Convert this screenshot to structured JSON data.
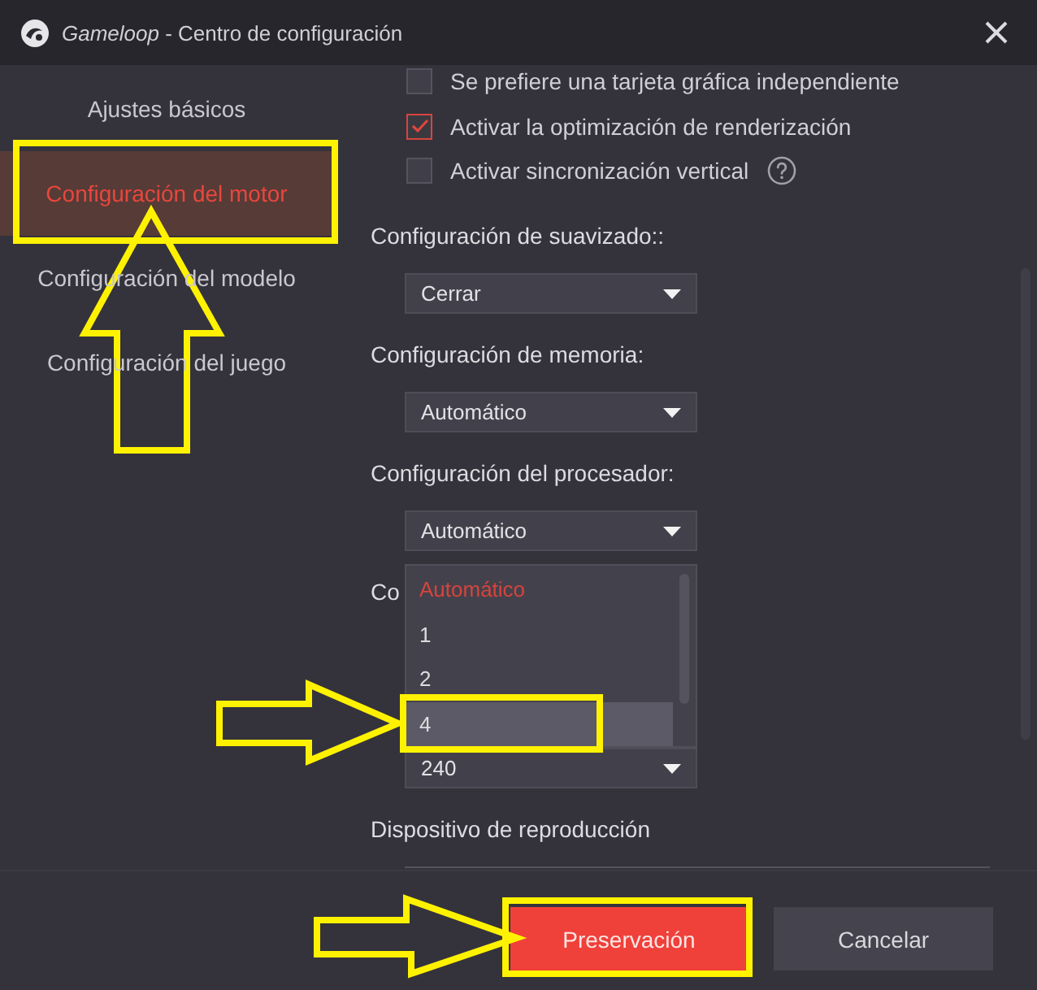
{
  "window": {
    "title": "*Gameloop* - Centro de configuración"
  },
  "sidebar": {
    "items": [
      {
        "label": "Ajustes básicos",
        "selected": false
      },
      {
        "label": "Configuración del motor",
        "selected": true
      },
      {
        "label": "Configuración del modelo",
        "selected": false
      },
      {
        "label": "Configuración del juego",
        "selected": false
      }
    ]
  },
  "options": [
    {
      "label": "Se prefiere una tarjeta gráfica independiente",
      "checked": false
    },
    {
      "label": "Activar la optimización de renderización",
      "checked": true
    },
    {
      "label": "Activar sincronización vertical",
      "checked": false,
      "help": true
    }
  ],
  "settings": [
    {
      "label": "Configuración de suavizado::",
      "value": "Cerrar"
    },
    {
      "label": "Configuración de memoria:",
      "value": "Automático"
    },
    {
      "label": "Configuración del procesador:",
      "value": "Automático"
    },
    {
      "label": "Co",
      "dropdown": {
        "options": [
          {
            "label": "Automático",
            "selected": true,
            "highlighted": false
          },
          {
            "label": "1",
            "selected": false,
            "highlighted": false
          },
          {
            "label": "2",
            "selected": false,
            "highlighted": false
          },
          {
            "label": "4",
            "selected": false,
            "highlighted": true
          }
        ]
      }
    },
    {
      "value": "240"
    },
    {
      "label": "Dispositivo de reproducción"
    }
  ],
  "buttons": [
    {
      "label": "Preservación",
      "kind": "primary"
    },
    {
      "label": "Cancelar",
      "kind": "secondary"
    }
  ]
}
